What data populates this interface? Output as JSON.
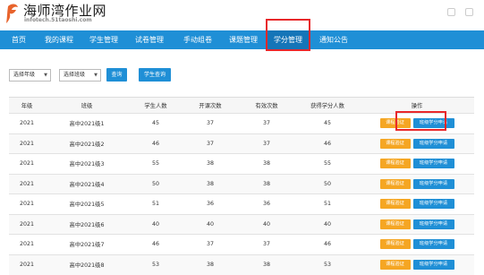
{
  "header": {
    "brand": "海师湾作业网",
    "url": "infotech.51taoshi.com",
    "logo_color": "#e8632c"
  },
  "nav": {
    "items": [
      "首页",
      "我的课程",
      "学生管理",
      "试卷管理",
      "手动组卷",
      "课题管理",
      "学分管理",
      "通知公告"
    ],
    "active": "学分管理",
    "bg": "#1f8fd6"
  },
  "filter": {
    "grade_select": "选择年级",
    "class_select": "选择班级",
    "query_button": "查询",
    "student_query_button": "学生查询"
  },
  "table": {
    "headers": [
      "年级",
      "班级",
      "学生人数",
      "开课次数",
      "有效次数",
      "获得学分人数",
      "操作"
    ],
    "rows": [
      [
        "2021",
        "高中2021级1",
        "45",
        "37",
        "37",
        "45"
      ],
      [
        "2021",
        "高中2021级2",
        "46",
        "37",
        "37",
        "46"
      ],
      [
        "2021",
        "高中2021级3",
        "55",
        "38",
        "38",
        "55"
      ],
      [
        "2021",
        "高中2021级4",
        "50",
        "38",
        "38",
        "50"
      ],
      [
        "2021",
        "高中2021级5",
        "51",
        "36",
        "36",
        "51"
      ],
      [
        "2021",
        "高中2021级6",
        "40",
        "40",
        "40",
        "40"
      ],
      [
        "2021",
        "高中2021级7",
        "46",
        "37",
        "37",
        "46"
      ],
      [
        "2021",
        "高中2021级8",
        "53",
        "38",
        "38",
        "53"
      ]
    ],
    "action_verify": "课程验证",
    "action_apply": "班级学分申请"
  }
}
